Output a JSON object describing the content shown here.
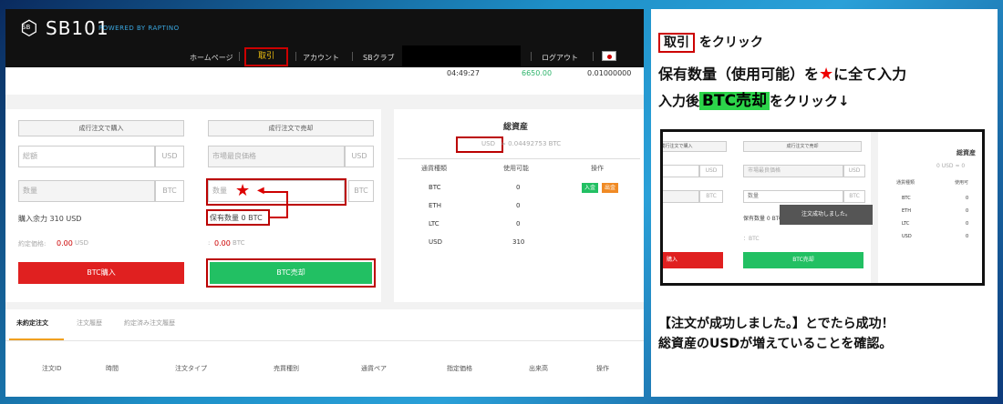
{
  "header": {
    "logo_mark": "SB",
    "logo_text": "SB101",
    "logo_sub": "POWERED BY RAPTINO",
    "nav": {
      "home": "ホームページ",
      "trade": "取引",
      "account": "アカウント",
      "club": "SBクラブ",
      "logout": "ログアウト"
    }
  },
  "ticker": {
    "time": "04:49:27",
    "price": "6650.00",
    "amount": "0.01000000"
  },
  "buy_panel": {
    "header": "成行注文で購入",
    "amount_placeholder": "総額",
    "amount_unit": "USD",
    "qty_placeholder": "数量",
    "qty_unit": "BTC",
    "available": "購入余力 310 USD",
    "contract_label": "約定価格:",
    "contract_value": "0.00",
    "contract_unit": "USD",
    "button": "BTC購入"
  },
  "sell_panel": {
    "header": "成行注文で売却",
    "price_placeholder": "市場最良価格",
    "price_unit": "USD",
    "qty_placeholder": "数量",
    "star": "★",
    "qty_unit": "BTC",
    "holding": "保有数量 0 BTC",
    "contract_prefix": ":",
    "contract_value": "0.00",
    "contract_unit": "BTC",
    "button": "BTC売却"
  },
  "assets": {
    "title": "総資産",
    "summary_currency": "USD",
    "summary_value": "≈ 0.04492753 BTC",
    "headers": [
      "通貨種類",
      "使用可能",
      "操作"
    ],
    "rows": [
      {
        "currency": "BTC",
        "available": "0"
      },
      {
        "currency": "ETH",
        "available": "0"
      },
      {
        "currency": "LTC",
        "available": "0"
      },
      {
        "currency": "USD",
        "available": "310"
      }
    ],
    "deposit": "入金",
    "withdraw": "出金"
  },
  "order_tabs": [
    "未約定注文",
    "注文履歴",
    "約定済み注文履歴"
  ],
  "order_columns": [
    "注文ID",
    "時間",
    "注文タイプ",
    "売買種別",
    "通貨ペア",
    "指定価格",
    "出来高",
    "操作"
  ],
  "instructions": {
    "step1_box": "取引",
    "step1_text": "をクリック",
    "step2_text_a": "保有数量（使用可能）を",
    "step2_star": "★",
    "step2_text_b": "に全て入力",
    "step3_text_a": "入力後",
    "step3_green": "BTC売却",
    "step3_text_b": "をクリック↓",
    "result_line1": "【注文が成功しました。】とでたら成功！",
    "result_line2": "総資産のUSDが増えていることを確認。"
  },
  "inset": {
    "buy_header": "成行注文で購入",
    "sell_header": "成行注文で売却",
    "usd": "USD",
    "btc": "BTC",
    "market_price": "市場最良価格",
    "qty": "数量",
    "holding": "保有数量 0 BTC",
    "contract": "：BTC",
    "buy_btn": "購入",
    "sell_btn": "BTC売却",
    "toast": "注文成功しました。",
    "assets_title": "総資産",
    "assets_summary": "0 USD ≈ 0",
    "headers": [
      "通貨種類",
      "使用可"
    ],
    "rows": [
      {
        "currency": "BTC",
        "available": "0"
      },
      {
        "currency": "ETH",
        "available": "0"
      },
      {
        "currency": "LTC",
        "available": "0"
      },
      {
        "currency": "USD",
        "available": "0"
      }
    ]
  },
  "colors": {
    "accent_red": "#c00000",
    "buy_red": "#e02020",
    "sell_green": "#22c063",
    "highlight_green": "#2cd44a"
  }
}
